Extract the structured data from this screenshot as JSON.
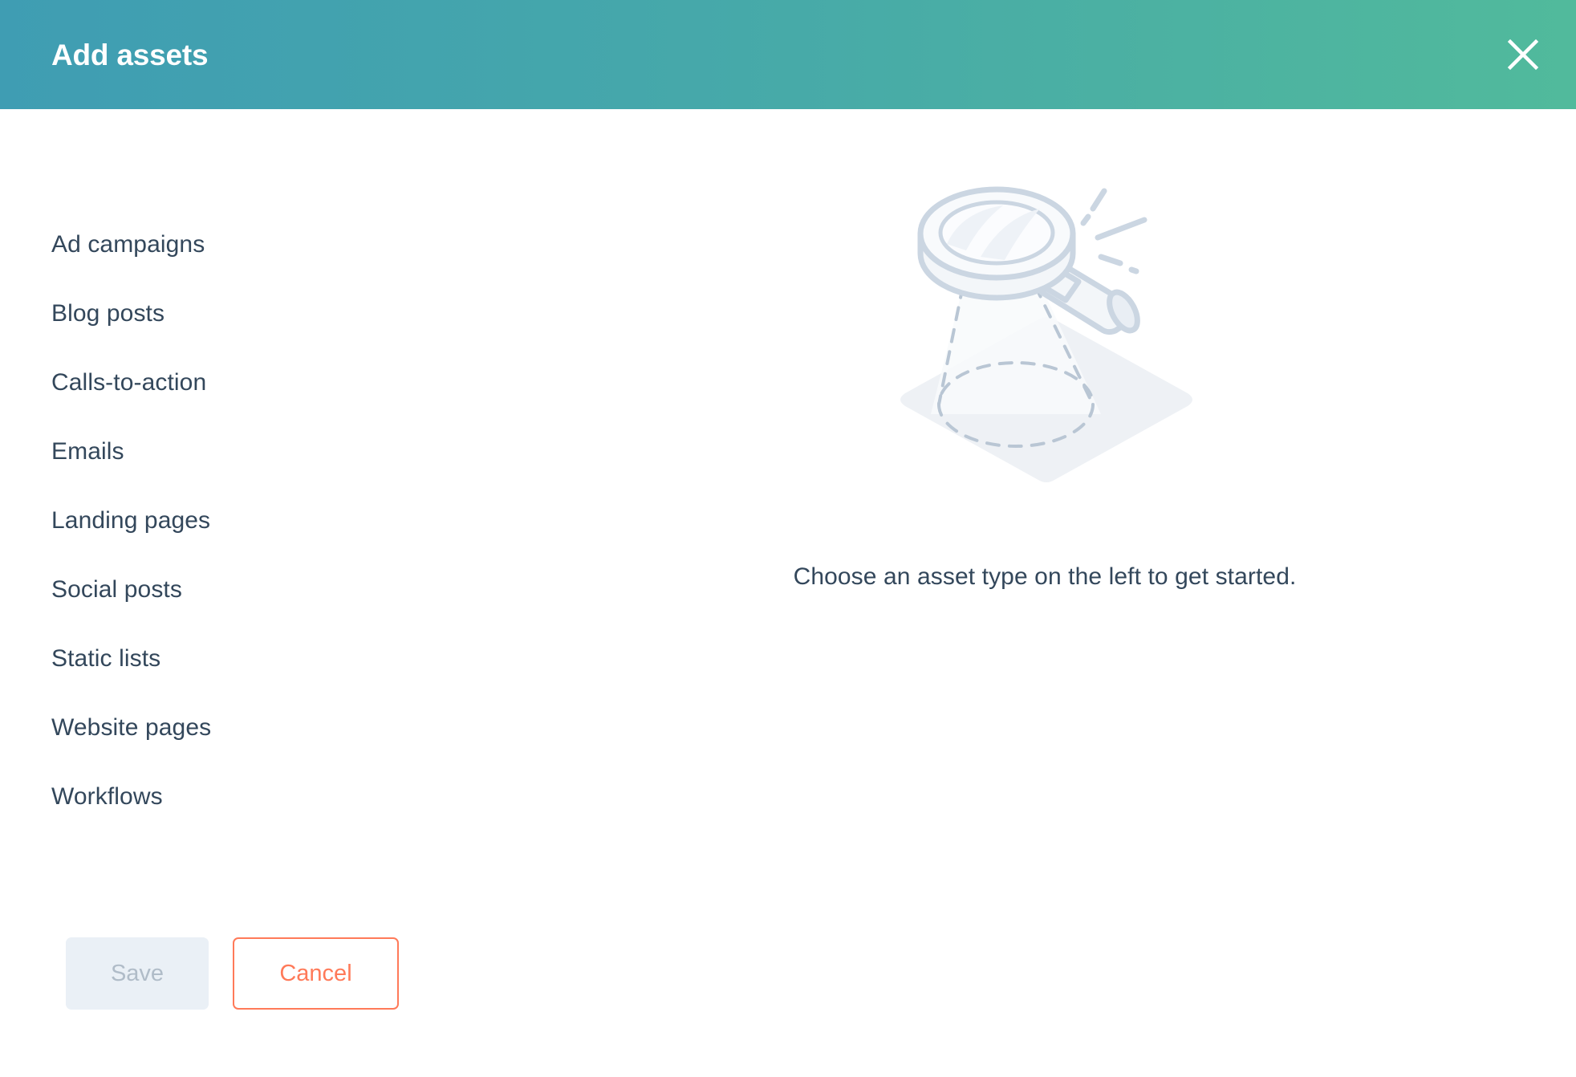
{
  "header": {
    "title": "Add assets",
    "close_icon": "close-icon",
    "gradient_start": "#3f9db3",
    "gradient_end": "#51ba9c",
    "title_color": "#ffffff"
  },
  "sidebar": {
    "items": [
      {
        "label": "Ad campaigns"
      },
      {
        "label": "Blog posts"
      },
      {
        "label": "Calls-to-action"
      },
      {
        "label": "Emails"
      },
      {
        "label": "Landing pages"
      },
      {
        "label": "Social posts"
      },
      {
        "label": "Static lists"
      },
      {
        "label": "Website pages"
      },
      {
        "label": "Workflows"
      }
    ],
    "text_color": "#33475b"
  },
  "empty_state": {
    "illustration_icon": "magnifying-glass-illustration",
    "caption": "Choose an asset type on the left to get started.",
    "caption_color": "#33475b",
    "illustration_fill": "#eef1f5",
    "illustration_stroke": "#cbd6e2"
  },
  "footer": {
    "save_label": "Save",
    "save_disabled": true,
    "save_bg": "#eaf0f6",
    "save_text_color": "#b0bcc8",
    "cancel_label": "Cancel",
    "cancel_color": "#ff7a59"
  }
}
